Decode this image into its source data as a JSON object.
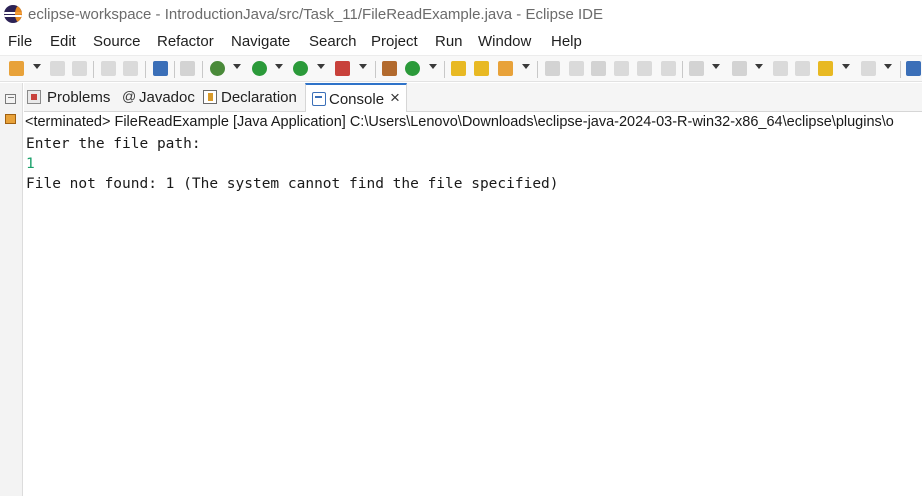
{
  "window": {
    "title": "eclipse-workspace - IntroductionJava/src/Task_11/FileReadExample.java - Eclipse IDE",
    "logo_icon": "eclipse-logo-icon"
  },
  "menu": {
    "items": [
      "File",
      "Edit",
      "Source",
      "Refactor",
      "Navigate",
      "Search",
      "Project",
      "Run",
      "Window",
      "Help"
    ]
  },
  "toolbar": {
    "icons": [
      "new-icon",
      "save-icon",
      "save-all-icon",
      "undo-icon",
      "redo-icon",
      "open-console-icon",
      "skip-breakpoints-icon",
      "debug-icon",
      "run-icon",
      "coverage-icon",
      "external-tools-icon",
      "new-java-project-icon",
      "new-java-class-icon",
      "open-type-icon",
      "open-task-icon",
      "search-icon",
      "annotation-icon",
      "mark-occurrences-icon",
      "block-selection-icon",
      "whitespace-icon",
      "next-annotation-icon",
      "previous-annotation-icon",
      "last-edit-icon",
      "back-icon",
      "forward-icon",
      "open-perspective-icon"
    ]
  },
  "side_strip": {
    "icons": [
      "restore-icon",
      "outline-icon"
    ]
  },
  "tabs": [
    {
      "label": "Problems",
      "icon": "problems-icon",
      "active": false
    },
    {
      "label": "Javadoc",
      "icon": "javadoc-icon",
      "active": false
    },
    {
      "label": "Declaration",
      "icon": "declaration-icon",
      "active": false
    },
    {
      "label": "Console",
      "icon": "console-icon",
      "active": true
    }
  ],
  "console": {
    "header": "<terminated> FileReadExample [Java Application] C:\\Users\\Lenovo\\Downloads\\eclipse-java-2024-03-R-win32-x86_64\\eclipse\\plugins\\o",
    "lines": [
      {
        "text": "Enter the file path:",
        "kind": "output"
      },
      {
        "text": "1",
        "kind": "input"
      },
      {
        "text": "File not found: 1 (The system cannot find the file specified)",
        "kind": "output"
      }
    ],
    "input_color": "#1aa06a"
  },
  "colors": {
    "accent": "#2f73c9",
    "menu_text": "#1f1f1f",
    "title_text": "#6b6b6b"
  }
}
